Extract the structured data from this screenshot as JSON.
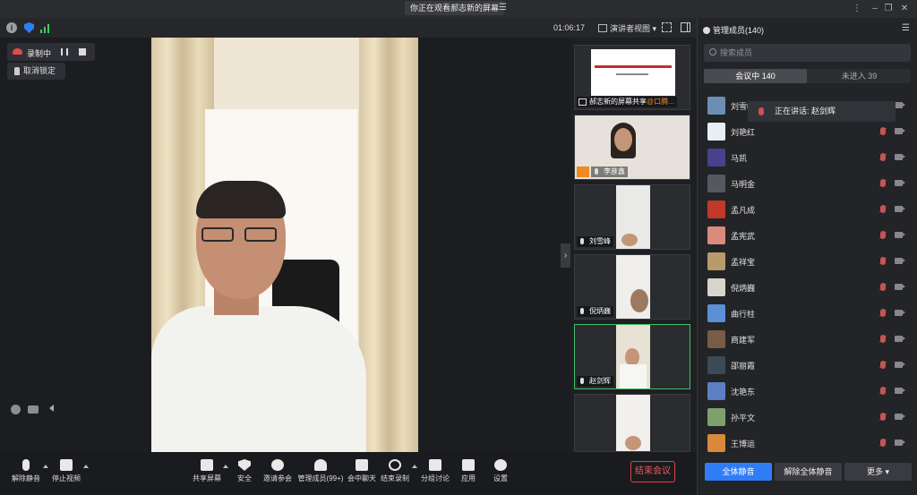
{
  "title": {
    "share_notice": "你正在观看郝志新的屏幕"
  },
  "status": {
    "timer": "01:06:17",
    "presenter_view": "演讲者视图"
  },
  "recording": {
    "label": "录制中",
    "unlock_label": "取消锁定"
  },
  "thumbnails": [
    {
      "name": "郝志新的屏幕共享",
      "extra": "@口腾..."
    },
    {
      "name": "李彦鑫"
    },
    {
      "name": "刘雪峰"
    },
    {
      "name": "倪炳巍"
    },
    {
      "name": "赵剑辉"
    }
  ],
  "panel": {
    "title": "管理成员(140)",
    "search_placeholder": "搜索成员",
    "tab_in_meeting": "会议中 140",
    "tab_not_joined": "未进入 39",
    "speaking": "正在讲话: 赵剑辉",
    "mute_all": "全体静音",
    "unmute_all": "解除全体静音",
    "more": "更多 ▾"
  },
  "members": [
    {
      "name": "刘雪峰",
      "color": "#6a8fb3"
    },
    {
      "name": "刘艳红",
      "color": "#e8eef5"
    },
    {
      "name": "马凯",
      "color": "#4b3f8f"
    },
    {
      "name": "马明金",
      "color": "#55595f"
    },
    {
      "name": "孟凡成",
      "color": "#c0392b"
    },
    {
      "name": "孟宪武",
      "color": "#d98c7a"
    },
    {
      "name": "孟祥宝",
      "color": "#b99a6b"
    },
    {
      "name": "倪炳巍",
      "color": "#d8d4cc"
    },
    {
      "name": "曲行柱",
      "color": "#5b8fd6"
    },
    {
      "name": "商建军",
      "color": "#7a5b45"
    },
    {
      "name": "邵丽霞",
      "color": "#3c4a57"
    },
    {
      "name": "沈艳东",
      "color": "#5c7fc4"
    },
    {
      "name": "孙平文",
      "color": "#7fa06a"
    },
    {
      "name": "王博运",
      "color": "#d88a3a"
    }
  ],
  "toolbar": {
    "unmute": "解除静音",
    "stop_video": "停止视频",
    "share_screen": "共享屏幕",
    "security": "安全",
    "invite": "邀请参会",
    "manage_members": "管理成员(99+)",
    "chat": "会中聊天",
    "end_record": "结束录制",
    "breakout": "分组讨论",
    "apps": "应用",
    "settings": "设置",
    "end_meeting": "结束会议"
  }
}
